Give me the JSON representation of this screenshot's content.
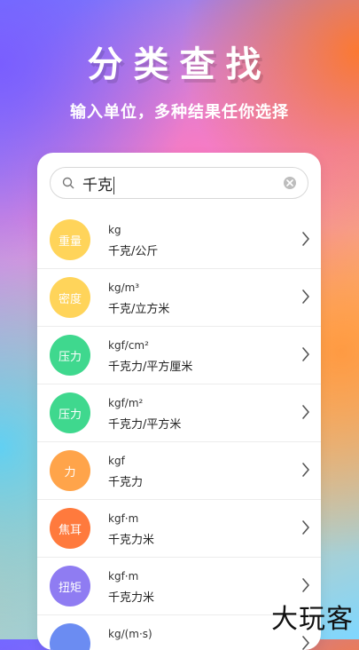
{
  "header": {
    "title": "分类查找",
    "subtitle": "输入单位，多种结果任你选择"
  },
  "search": {
    "value": "千克",
    "icon": "search-icon",
    "clear_icon": "clear-icon"
  },
  "colors": {
    "yellow": "#ffd45a",
    "green": "#3fd88e",
    "orange": "#ffa44a",
    "red_orange": "#ff7a3d",
    "purple": "#8f7cf2",
    "blue": "#6b8cf2"
  },
  "results": [
    {
      "badge": "重量",
      "unit": "kg",
      "name": "千克/公斤",
      "color": "#ffd45a"
    },
    {
      "badge": "密度",
      "unit": "kg/m³",
      "name": "千克/立方米",
      "color": "#ffd45a"
    },
    {
      "badge": "压力",
      "unit": "kgf/cm²",
      "name": "千克力/平方厘米",
      "color": "#3fd88e"
    },
    {
      "badge": "压力",
      "unit": "kgf/m²",
      "name": "千克力/平方米",
      "color": "#3fd88e"
    },
    {
      "badge": "力",
      "unit": "kgf",
      "name": "千克力",
      "color": "#ffa44a"
    },
    {
      "badge": "焦耳",
      "unit": "kgf·m",
      "name": "千克力米",
      "color": "#ff7a3d"
    },
    {
      "badge": "扭矩",
      "unit": "kgf·m",
      "name": "千克力米",
      "color": "#8f7cf2"
    },
    {
      "badge": "",
      "unit": "kg/(m·s)",
      "name": "",
      "color": "#6b8cf2"
    }
  ],
  "watermark": "大玩客"
}
